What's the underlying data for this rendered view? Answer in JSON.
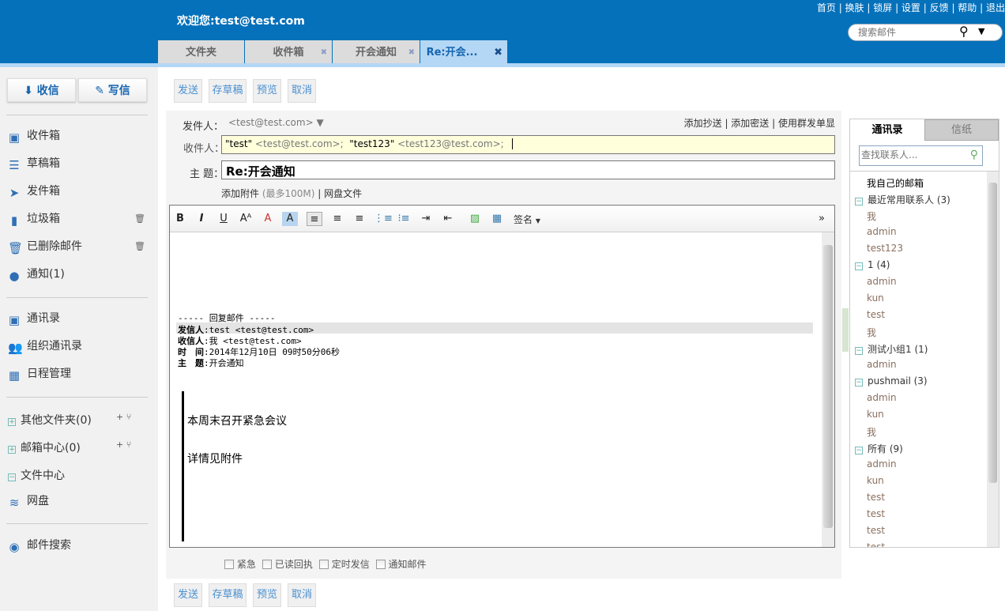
{
  "header": {
    "welcome": "欢迎您:test@test.com",
    "links": [
      "首页",
      "换肤",
      "锁屏",
      "设置",
      "反馈",
      "帮助",
      "退出"
    ],
    "search_placeholder": "搜索邮件"
  },
  "tabs": [
    {
      "label": "文件夹"
    },
    {
      "label": "收件箱"
    },
    {
      "label": "开会通知"
    },
    {
      "label": "Re:开会..."
    }
  ],
  "sidebar": {
    "receive": "收信",
    "compose": "写信",
    "folders": [
      {
        "label": "收件箱"
      },
      {
        "label": "草稿箱"
      },
      {
        "label": "发件箱"
      },
      {
        "label": "垃圾箱"
      },
      {
        "label": "已删除邮件"
      },
      {
        "label": "通知(1)"
      }
    ],
    "apps": [
      {
        "label": "通讯录"
      },
      {
        "label": "组织通讯录"
      },
      {
        "label": "日程管理"
      }
    ],
    "other": [
      {
        "label": "其他文件夹(0)"
      },
      {
        "label": "邮箱中心(0)"
      },
      {
        "label": "文件中心"
      },
      {
        "label": "网盘"
      }
    ],
    "search": "邮件搜索"
  },
  "actions": {
    "send": "发送",
    "draft": "存草稿",
    "preview": "预览",
    "cancel": "取消"
  },
  "compose": {
    "from_label": "发件人：",
    "from": "<test@test.com>",
    "add_cc": "添加抄送",
    "add_bcc": "添加密送",
    "group_send": "使用群发单显",
    "to_label": "收件人：",
    "to": [
      {
        "name": "\"test\"",
        "addr": "<test@test.com>;"
      },
      {
        "name": "\"test123\"",
        "addr": "<test123@test.com>;"
      }
    ],
    "subject_label": "主 题：",
    "subject": "Re:开会通知",
    "attach": "添加附件",
    "attach_limit": "(最多100M)",
    "netdisk": "网盘文件",
    "signature": "签名"
  },
  "body": {
    "reply_header": "----- 回复邮件 -----",
    "from_k": "发信人",
    "from_v": ":test <test@test.com>",
    "to_k": "收信人",
    "to_v": ":我 <test@test.com>",
    "time_k": "时　间",
    "time_v": ":2014年12月10日 09时50分06秒",
    "subj_k": "主　题",
    "subj_v": ":开会通知",
    "line1": "本周末召开紧急会议",
    "line2": "详情见附件"
  },
  "options": [
    "紧急",
    "已读回执",
    "定时发信",
    "通知邮件"
  ],
  "contacts": {
    "tab_contacts": "通讯录",
    "tab_stationery": "信纸",
    "search_placeholder": "查找联系人...",
    "self": "我自己的邮箱",
    "groups": [
      {
        "name": "最近常用联系人 (3)",
        "members": [
          "我",
          "admin",
          "test123"
        ]
      },
      {
        "name": "1 (4)",
        "members": [
          "admin",
          "kun",
          "test",
          "我"
        ]
      },
      {
        "name": "测试小组1 (1)",
        "members": [
          "admin"
        ]
      },
      {
        "name": "pushmail (3)",
        "members": [
          "admin",
          "kun",
          "我"
        ]
      },
      {
        "name": "所有 (9)",
        "members": [
          "admin",
          "kun",
          "test",
          "test",
          "test",
          "test"
        ]
      }
    ]
  }
}
